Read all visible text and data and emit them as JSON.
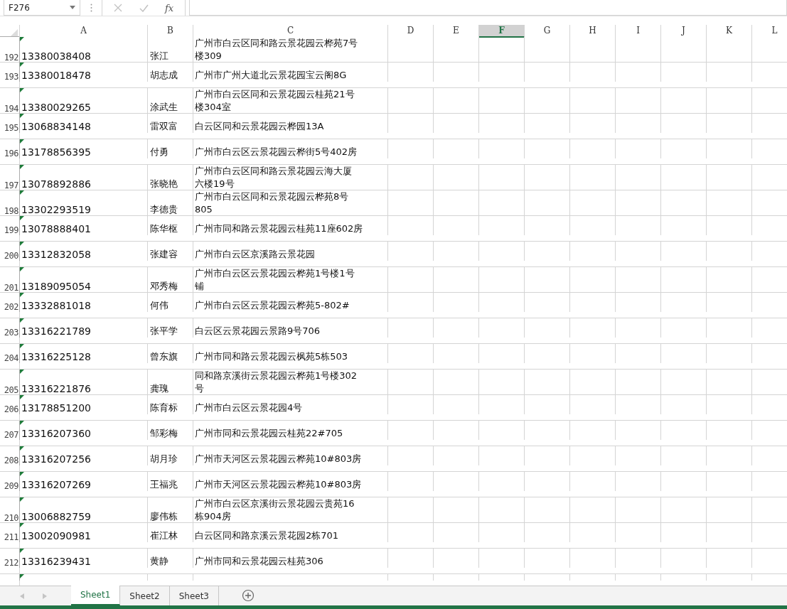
{
  "formula_bar": {
    "name_box": "F276",
    "function_label": "fx",
    "cancel_disabled": true,
    "enter_disabled": true
  },
  "columns": [
    {
      "label": "A",
      "selected": false
    },
    {
      "label": "B",
      "selected": false
    },
    {
      "label": "C",
      "selected": false
    },
    {
      "label": "D",
      "selected": false
    },
    {
      "label": "E",
      "selected": false
    },
    {
      "label": "F",
      "selected": true
    },
    {
      "label": "G",
      "selected": false
    },
    {
      "label": "H",
      "selected": false
    },
    {
      "label": "I",
      "selected": false
    },
    {
      "label": "J",
      "selected": false
    },
    {
      "label": "K",
      "selected": false
    },
    {
      "label": "L",
      "selected": false
    }
  ],
  "rows": [
    {
      "number": "192",
      "phone": "13380038408",
      "name": "张江",
      "address": [
        "广州市白云区同和路云景花园云桦苑7号",
        "楼309"
      ],
      "error_indicator": true
    },
    {
      "number": "193",
      "phone": "13380018478",
      "name": "胡志成",
      "address": [
        "广州市广州大道北云景花园宝云阁8G"
      ],
      "error_indicator": true
    },
    {
      "number": "194",
      "phone": "13380029265",
      "name": "涂武生",
      "address": [
        "广州市白云区同和云景花园云桂苑21号",
        "楼304室"
      ],
      "error_indicator": true
    },
    {
      "number": "195",
      "phone": "13068834148",
      "name": "雷双富",
      "address": [
        "白云区同和云景花园云桦园13A"
      ],
      "error_indicator": true
    },
    {
      "number": "196",
      "phone": "13178856395",
      "name": "付勇",
      "address": [
        "广州市白云区云景花园云桦街5号402房"
      ],
      "error_indicator": true
    },
    {
      "number": "197",
      "phone": "13078892886",
      "name": "张晓艳",
      "address": [
        "广州市白云区同和路云景花园云海大厦",
        "六楼19号"
      ],
      "error_indicator": true
    },
    {
      "number": "198",
      "phone": "13302293519",
      "name": "李德贵",
      "address": [
        "广州市白云区同和云景花园云桦苑8号",
        "805"
      ],
      "error_indicator": true
    },
    {
      "number": "199",
      "phone": "13078888401",
      "name": "陈华枢",
      "address": [
        "广州市同和路云景花园云桂苑11座602房"
      ],
      "error_indicator": true
    },
    {
      "number": "200",
      "phone": "13312832058",
      "name": "张建容",
      "address": [
        "广州市白云区京溪路云景花园"
      ],
      "error_indicator": true
    },
    {
      "number": "201",
      "phone": "13189095054",
      "name": "邓秀梅",
      "address": [
        "广州市白云区云景花园云桦苑1号楼1号",
        "铺"
      ],
      "error_indicator": true
    },
    {
      "number": "202",
      "phone": "13332881018",
      "name": "何伟",
      "address": [
        "广州市白云区云景花园云桦苑5-802#"
      ],
      "error_indicator": true
    },
    {
      "number": "203",
      "phone": "13316221789",
      "name": "张平学",
      "address": [
        "白云区云景花园云景路9号706"
      ],
      "error_indicator": true
    },
    {
      "number": "204",
      "phone": "13316225128",
      "name": "曾东旗",
      "address": [
        "广州市同和路云景花园云枫苑5栋503"
      ],
      "error_indicator": true
    },
    {
      "number": "205",
      "phone": "13316221876",
      "name": "龚瑰",
      "address": [
        "同和路京溪街云景花园云桦苑1号楼302",
        "号"
      ],
      "error_indicator": true
    },
    {
      "number": "206",
      "phone": "13178851200",
      "name": "陈育标",
      "address": [
        "广州市白云区云景花园4号"
      ],
      "error_indicator": true
    },
    {
      "number": "207",
      "phone": "13316207360",
      "name": "邹彩梅",
      "address": [
        "广州市同和云景花园云桂苑22#705"
      ],
      "error_indicator": true
    },
    {
      "number": "208",
      "phone": "13316207256",
      "name": "胡月珍",
      "address": [
        "广州市天河区云景花园云桦苑10#803房"
      ],
      "error_indicator": true
    },
    {
      "number": "209",
      "phone": "13316207269",
      "name": "王福兆",
      "address": [
        "广州市天河区云景花园云桦苑10#803房"
      ],
      "error_indicator": true
    },
    {
      "number": "210",
      "phone": "13006882759",
      "name": "廖伟栋",
      "address": [
        "广州市白云区京溪街云景花园云贵苑16",
        "栋904房"
      ],
      "error_indicator": true
    },
    {
      "number": "211",
      "phone": "13002090981",
      "name": "崔江林",
      "address": [
        "白云区同和路京溪云景花园2栋701"
      ],
      "error_indicator": true
    },
    {
      "number": "212",
      "phone": "13316239431",
      "name": "黄静",
      "address": [
        "广州市同和云景花园云桂苑306"
      ],
      "error_indicator": true
    }
  ],
  "partial_row": {
    "error_indicator": true
  },
  "sheet_tabs": [
    {
      "label": "Sheet1",
      "selected": true
    },
    {
      "label": "Sheet2",
      "selected": false
    },
    {
      "label": "Sheet3",
      "selected": false
    }
  ]
}
